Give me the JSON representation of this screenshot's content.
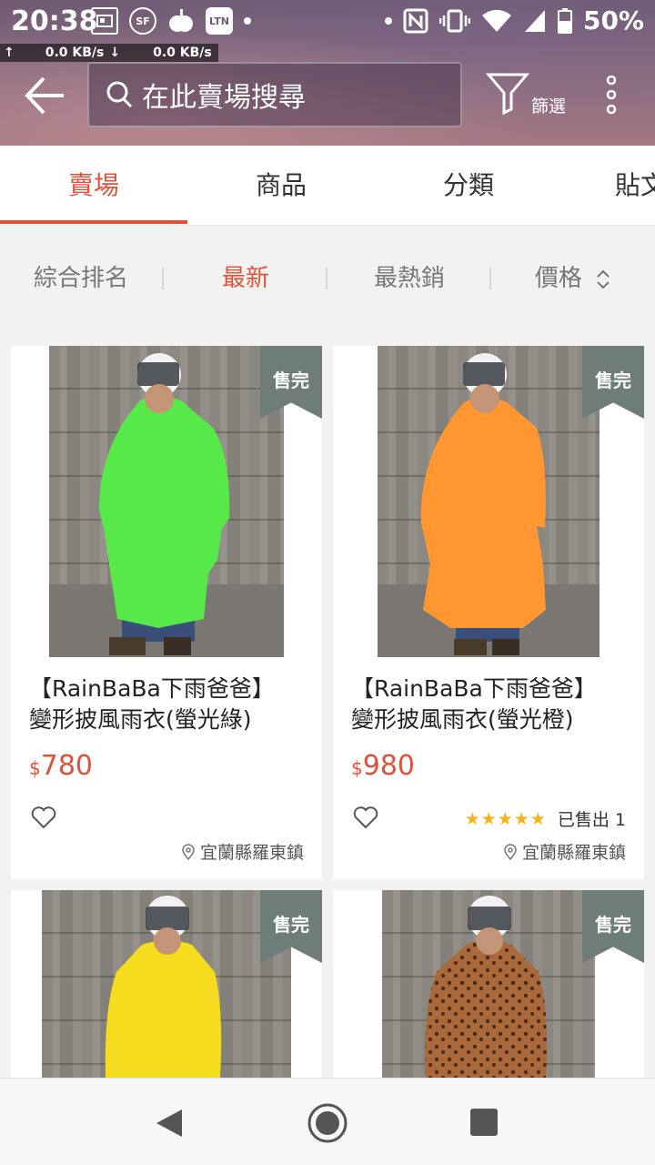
{
  "status": {
    "time": "20:38",
    "notif_icons": [
      "news-icon",
      "sf-icon",
      "apple-daily-icon",
      "LTN"
    ],
    "notif_ltn_label": "LTN",
    "battery": "50%",
    "upload_speed": "0.0 KB/s",
    "download_speed": "0.0 KB/s"
  },
  "header": {
    "search_placeholder": "在此賣場搜尋",
    "filter_label": "篩選"
  },
  "tabs": [
    {
      "label": "賣場",
      "active": true
    },
    {
      "label": "商品",
      "active": false
    },
    {
      "label": "分類",
      "active": false
    },
    {
      "label": "貼文",
      "active": false
    }
  ],
  "sort": [
    {
      "label": "綜合排名",
      "active": false
    },
    {
      "label": "最新",
      "active": true
    },
    {
      "label": "最熱銷",
      "active": false
    },
    {
      "label": "價格",
      "active": false
    }
  ],
  "products": [
    {
      "badge": "售完",
      "title_line1": "【RainBaBa下雨爸爸】",
      "title_line2": "變形披風雨衣(螢光綠)",
      "currency": "$",
      "price": "780",
      "location": "宜蘭縣羅東鎮",
      "color": "#57e84a"
    },
    {
      "badge": "售完",
      "title_line1": "【RainBaBa下雨爸爸】",
      "title_line2": "變形披風雨衣(螢光橙)",
      "currency": "$",
      "price": "980",
      "rating_stars": 5,
      "sold_text": "已售出 1",
      "location": "宜蘭縣羅東鎮",
      "color": "#ff9630"
    },
    {
      "badge": "售完",
      "color": "#f5dc1e"
    },
    {
      "badge": "售完",
      "color": "#a9693a"
    }
  ],
  "accent_color": "#e0513a"
}
